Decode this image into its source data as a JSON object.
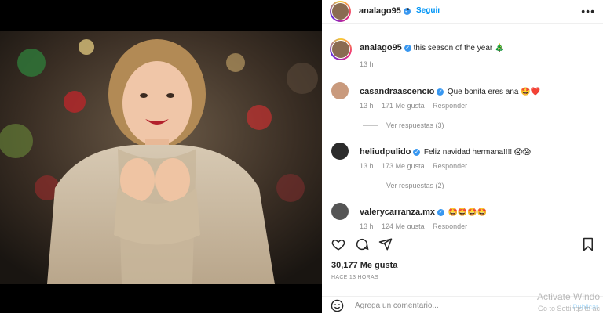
{
  "post": {
    "author": "analago95",
    "follow_label": "Seguir",
    "caption": "this season of the year",
    "caption_emoji": "🎄",
    "caption_age": "13 h",
    "likes_label": "30,177 Me gusta",
    "posted_ago": "HACE 13 HORAS",
    "comment_placeholder": "Agrega un comentario...",
    "publish_label": "Publicar"
  },
  "dot_separator": "•",
  "comments": [
    {
      "user": "casandraascencio",
      "text": "Que bonita eres ana 🤩❤️",
      "age": "13 h",
      "likes": "171 Me gusta",
      "reply": "Responder",
      "view_replies": "Ver respuestas (3)"
    },
    {
      "user": "heliudpulido",
      "text": "Feliz navidad hermana!!!! 😱😱",
      "age": "13 h",
      "likes": "173 Me gusta",
      "reply": "Responder",
      "view_replies": "Ver respuestas (2)"
    },
    {
      "user": "valerycarranza.mx",
      "text": "🤩🤩🤩🤩",
      "age": "13 h",
      "likes": "124 Me gusta",
      "reply": "Responder"
    }
  ],
  "watermark": {
    "line1": "Activate Windo",
    "line2": "Go to Settings to ac"
  },
  "icons": [
    "more-options-icon",
    "heart-icon",
    "comment-icon",
    "share-icon",
    "bookmark-icon",
    "emoji-icon",
    "verified-icon"
  ]
}
